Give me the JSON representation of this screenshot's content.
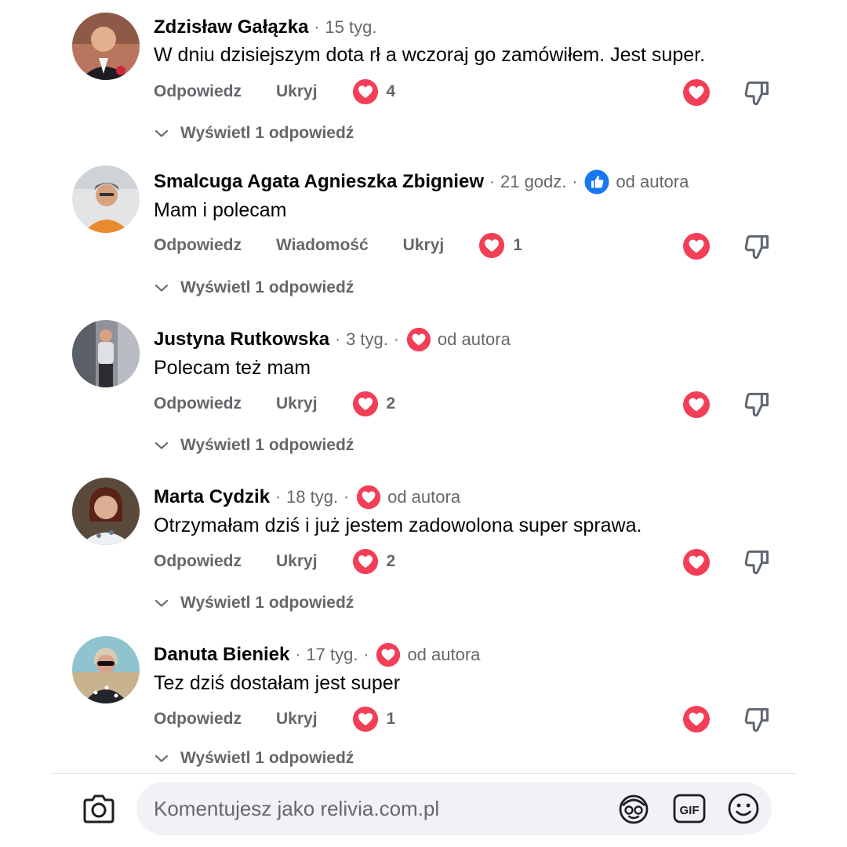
{
  "colors": {
    "love_red": "#f33e58",
    "like_blue": "#1877f2",
    "secondary_text": "#65676b",
    "input_bg": "#f0f2f5"
  },
  "labels": {
    "reply": "Odpowiedz",
    "message": "Wiadomość",
    "hide": "Ukryj",
    "view_replies": "Wyświetl 1 odpowiedź",
    "separator": "·"
  },
  "comments": [
    {
      "author": "Zdzisław Gałązka",
      "time": "15 tyg.",
      "text": "W dniu dzisiejszym dota rł  a wczoraj go zamówiłem. Jest super.",
      "reaction_count": "4"
    },
    {
      "author": "Smalcuga Agata Agnieszka Zbigniew",
      "time": "21 godz.",
      "badge_icon": "like-icon",
      "badge_text": "od autora",
      "text": "Mam i polecam",
      "reaction_count": "1"
    },
    {
      "author": "Justyna Rutkowska",
      "time": "3 tyg.",
      "badge_icon": "love-icon",
      "badge_text": "od autora",
      "text": "Polecam też mam",
      "reaction_count": "2"
    },
    {
      "author": "Marta Cydzik",
      "time": "18 tyg.",
      "badge_icon": "love-icon",
      "badge_text": "od autora",
      "text": "Otrzymałam dziś i już jestem zadowolona super sprawa.",
      "reaction_count": "2"
    },
    {
      "author": "Danuta Bieniek",
      "time": "17 tyg.",
      "badge_icon": "love-icon",
      "badge_text": "od autora",
      "text": "Tez dziś dostałam jest super",
      "reaction_count": "1"
    }
  ],
  "composer": {
    "placeholder": "Komentujesz jako relivia.com.pl",
    "icons": [
      "camera-icon",
      "avatar-sticker-icon",
      "gif-icon",
      "emoji-icon"
    ]
  }
}
